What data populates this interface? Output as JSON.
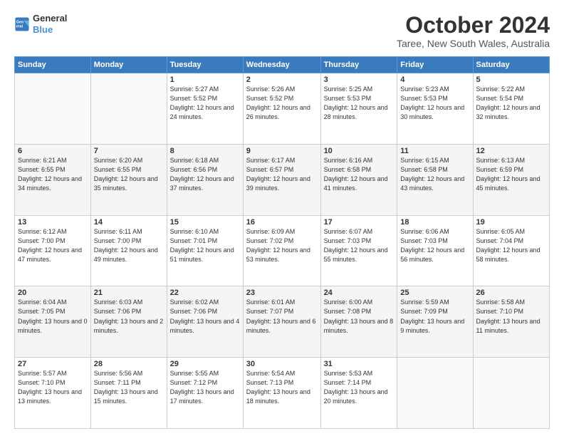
{
  "logo": {
    "line1": "General",
    "line2": "Blue"
  },
  "title": "October 2024",
  "subtitle": "Taree, New South Wales, Australia",
  "days_header": [
    "Sunday",
    "Monday",
    "Tuesday",
    "Wednesday",
    "Thursday",
    "Friday",
    "Saturday"
  ],
  "weeks": [
    [
      {
        "num": "",
        "text": ""
      },
      {
        "num": "",
        "text": ""
      },
      {
        "num": "1",
        "text": "Sunrise: 5:27 AM\nSunset: 5:52 PM\nDaylight: 12 hours and 24 minutes."
      },
      {
        "num": "2",
        "text": "Sunrise: 5:26 AM\nSunset: 5:52 PM\nDaylight: 12 hours and 26 minutes."
      },
      {
        "num": "3",
        "text": "Sunrise: 5:25 AM\nSunset: 5:53 PM\nDaylight: 12 hours and 28 minutes."
      },
      {
        "num": "4",
        "text": "Sunrise: 5:23 AM\nSunset: 5:53 PM\nDaylight: 12 hours and 30 minutes."
      },
      {
        "num": "5",
        "text": "Sunrise: 5:22 AM\nSunset: 5:54 PM\nDaylight: 12 hours and 32 minutes."
      }
    ],
    [
      {
        "num": "6",
        "text": "Sunrise: 6:21 AM\nSunset: 6:55 PM\nDaylight: 12 hours and 34 minutes."
      },
      {
        "num": "7",
        "text": "Sunrise: 6:20 AM\nSunset: 6:55 PM\nDaylight: 12 hours and 35 minutes."
      },
      {
        "num": "8",
        "text": "Sunrise: 6:18 AM\nSunset: 6:56 PM\nDaylight: 12 hours and 37 minutes."
      },
      {
        "num": "9",
        "text": "Sunrise: 6:17 AM\nSunset: 6:57 PM\nDaylight: 12 hours and 39 minutes."
      },
      {
        "num": "10",
        "text": "Sunrise: 6:16 AM\nSunset: 6:58 PM\nDaylight: 12 hours and 41 minutes."
      },
      {
        "num": "11",
        "text": "Sunrise: 6:15 AM\nSunset: 6:58 PM\nDaylight: 12 hours and 43 minutes."
      },
      {
        "num": "12",
        "text": "Sunrise: 6:13 AM\nSunset: 6:59 PM\nDaylight: 12 hours and 45 minutes."
      }
    ],
    [
      {
        "num": "13",
        "text": "Sunrise: 6:12 AM\nSunset: 7:00 PM\nDaylight: 12 hours and 47 minutes."
      },
      {
        "num": "14",
        "text": "Sunrise: 6:11 AM\nSunset: 7:00 PM\nDaylight: 12 hours and 49 minutes."
      },
      {
        "num": "15",
        "text": "Sunrise: 6:10 AM\nSunset: 7:01 PM\nDaylight: 12 hours and 51 minutes."
      },
      {
        "num": "16",
        "text": "Sunrise: 6:09 AM\nSunset: 7:02 PM\nDaylight: 12 hours and 53 minutes."
      },
      {
        "num": "17",
        "text": "Sunrise: 6:07 AM\nSunset: 7:03 PM\nDaylight: 12 hours and 55 minutes."
      },
      {
        "num": "18",
        "text": "Sunrise: 6:06 AM\nSunset: 7:03 PM\nDaylight: 12 hours and 56 minutes."
      },
      {
        "num": "19",
        "text": "Sunrise: 6:05 AM\nSunset: 7:04 PM\nDaylight: 12 hours and 58 minutes."
      }
    ],
    [
      {
        "num": "20",
        "text": "Sunrise: 6:04 AM\nSunset: 7:05 PM\nDaylight: 13 hours and 0 minutes."
      },
      {
        "num": "21",
        "text": "Sunrise: 6:03 AM\nSunset: 7:06 PM\nDaylight: 13 hours and 2 minutes."
      },
      {
        "num": "22",
        "text": "Sunrise: 6:02 AM\nSunset: 7:06 PM\nDaylight: 13 hours and 4 minutes."
      },
      {
        "num": "23",
        "text": "Sunrise: 6:01 AM\nSunset: 7:07 PM\nDaylight: 13 hours and 6 minutes."
      },
      {
        "num": "24",
        "text": "Sunrise: 6:00 AM\nSunset: 7:08 PM\nDaylight: 13 hours and 8 minutes."
      },
      {
        "num": "25",
        "text": "Sunrise: 5:59 AM\nSunset: 7:09 PM\nDaylight: 13 hours and 9 minutes."
      },
      {
        "num": "26",
        "text": "Sunrise: 5:58 AM\nSunset: 7:10 PM\nDaylight: 13 hours and 11 minutes."
      }
    ],
    [
      {
        "num": "27",
        "text": "Sunrise: 5:57 AM\nSunset: 7:10 PM\nDaylight: 13 hours and 13 minutes."
      },
      {
        "num": "28",
        "text": "Sunrise: 5:56 AM\nSunset: 7:11 PM\nDaylight: 13 hours and 15 minutes."
      },
      {
        "num": "29",
        "text": "Sunrise: 5:55 AM\nSunset: 7:12 PM\nDaylight: 13 hours and 17 minutes."
      },
      {
        "num": "30",
        "text": "Sunrise: 5:54 AM\nSunset: 7:13 PM\nDaylight: 13 hours and 18 minutes."
      },
      {
        "num": "31",
        "text": "Sunrise: 5:53 AM\nSunset: 7:14 PM\nDaylight: 13 hours and 20 minutes."
      },
      {
        "num": "",
        "text": ""
      },
      {
        "num": "",
        "text": ""
      }
    ]
  ]
}
